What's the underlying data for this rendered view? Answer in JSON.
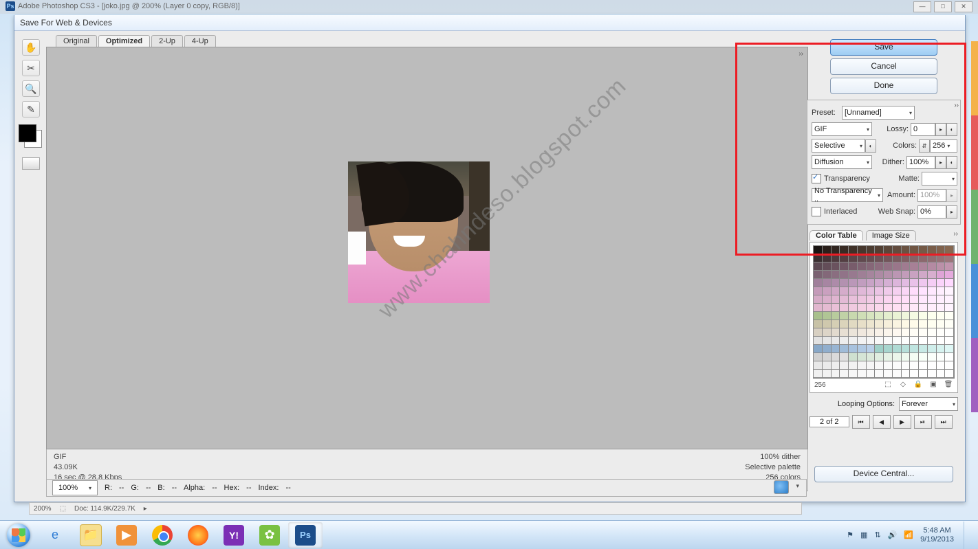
{
  "ps_window": {
    "title": "Adobe Photoshop CS3 - [joko.jpg @ 200% (Layer 0 copy, RGB/8)]"
  },
  "dialog": {
    "title": "Save For Web & Devices",
    "tabs": {
      "original": "Original",
      "optimized": "Optimized",
      "two_up": "2-Up",
      "four_up": "4-Up"
    },
    "watermark": "www.chahndeso.blogspot.com",
    "status_left": {
      "format": "GIF",
      "size": "43.09K",
      "time": "16 sec @ 28.8 Kbps"
    },
    "status_right": {
      "dither": "100% dither",
      "palette": "Selective palette",
      "colors": "256 colors"
    }
  },
  "actions": {
    "save": "Save",
    "cancel": "Cancel",
    "done": "Done",
    "device_central": "Device Central..."
  },
  "settings": {
    "preset_label": "Preset:",
    "preset_value": "[Unnamed]",
    "format_value": "GIF",
    "lossy_label": "Lossy:",
    "lossy_value": "0",
    "reduction_value": "Selective",
    "colors_label": "Colors:",
    "colors_value": "256",
    "dither_method_value": "Diffusion",
    "dither_label": "Dither:",
    "dither_value": "100%",
    "transparency_label": "Transparency",
    "matte_label": "Matte:",
    "trans_dither_value": "No Transparency ..",
    "amount_label": "Amount:",
    "amount_value": "100%",
    "interlaced_label": "Interlaced",
    "websnap_label": "Web Snap:",
    "websnap_value": "0%"
  },
  "panel_tabs": {
    "color_table": "Color Table",
    "image_size": "Image Size"
  },
  "color_table": {
    "count": "256"
  },
  "looping": {
    "label": "Looping Options:",
    "value": "Forever"
  },
  "frames": {
    "pos": "2 of 2"
  },
  "bottom": {
    "zoom": "100%",
    "readout": {
      "r": "R:",
      "g": "G:",
      "b": "B:",
      "alpha": "Alpha:",
      "hex": "Hex:",
      "index": "Index:",
      "dash": "--"
    }
  },
  "ps_strip": {
    "zoom": "200%",
    "doc": "Doc: 114.9K/229.7K"
  },
  "tray": {
    "time": "5:48 AM",
    "date": "9/19/2013"
  },
  "color_palette": [
    "#1a1412",
    "#2a1f1a",
    "#302520",
    "#382b24",
    "#3f3128",
    "#46372d",
    "#4c3c31",
    "#523f33",
    "#5a4639",
    "#624c3e",
    "#6a5242",
    "#705644",
    "#755a47",
    "#7a5e4a",
    "#80624d",
    "#866750",
    "#3a2e30",
    "#443438",
    "#4d3a3e",
    "#533e42",
    "#5a4549",
    "#60494e",
    "#664d52",
    "#6c5156",
    "#72555a",
    "#785a5f",
    "#7e5e63",
    "#856368",
    "#8b686d",
    "#906c71",
    "#967075",
    "#9c757a",
    "#5c4852",
    "#634d58",
    "#6a525e",
    "#715765",
    "#785c6b",
    "#7f6272",
    "#866778",
    "#8d6c7e",
    "#937184",
    "#9a768a",
    "#a07b90",
    "#a78096",
    "#ae859c",
    "#b48aa2",
    "#bb90a8",
    "#c295ae",
    "#7b6272",
    "#836879",
    "#8a6e80",
    "#917388",
    "#98798f",
    "#9f7f96",
    "#a6859d",
    "#ad8aa4",
    "#b490ab",
    "#bb96b3",
    "#c29cba",
    "#c9a2c1",
    "#d0a8c8",
    "#d7aecf",
    "#dea4d6",
    "#e5aadd",
    "#a07f9b",
    "#a785a2",
    "#ad8ba9",
    "#b391b0",
    "#ba97b8",
    "#c19dbf",
    "#c8a3c6",
    "#cfa9cd",
    "#d5afd4",
    "#dcb5db",
    "#e2bbe2",
    "#e9c1e9",
    "#efc7ef",
    "#f5cdf5",
    "#fbd3fb",
    "#ffd9ff",
    "#c49ab9",
    "#caa0bf",
    "#cfa6c5",
    "#d5accb",
    "#dab2d1",
    "#e0b8d8",
    "#e5bede",
    "#ebc4e4",
    "#f0caea",
    "#f5d0f0",
    "#fad6f6",
    "#ffdcfc",
    "#ffe2ff",
    "#ffe8ff",
    "#ffeeff",
    "#fff4ff",
    "#d5aac6",
    "#daafcb",
    "#dfb4d0",
    "#e3bad5",
    "#e8bfda",
    "#edc4df",
    "#f1cae4",
    "#f6cfea",
    "#fad4ef",
    "#fed9f4",
    "#ffdef8",
    "#ffe3fb",
    "#ffe7fd",
    "#ffebff",
    "#ffefff",
    "#fff2ff",
    "#e1b6ce",
    "#e5bbd2",
    "#e9c0d7",
    "#edc5db",
    "#f0cadf",
    "#f4cfe3",
    "#f8d3e8",
    "#fbd8ec",
    "#fedcf0",
    "#ffe0f3",
    "#ffe4f6",
    "#ffe8f9",
    "#ffebfb",
    "#ffeefc",
    "#fff1fe",
    "#fff4ff",
    "#a8c08c",
    "#b0c695",
    "#b8cc9d",
    "#c0d2a6",
    "#c8d8ae",
    "#cfdeb6",
    "#d7e4bf",
    "#dde9c6",
    "#e4eece",
    "#eaf3d5",
    "#f0f7dc",
    "#f5fbe3",
    "#fafee9",
    "#fdffee",
    "#fffff2",
    "#fffff6",
    "#c8c2a6",
    "#cfc8ad",
    "#d5ceb4",
    "#dbd4bb",
    "#e1dac2",
    "#e7dfc8",
    "#ece5cf",
    "#f1ead5",
    "#f6efdb",
    "#faf4e1",
    "#fdf8e6",
    "#fffbea",
    "#fffdee",
    "#fffff1",
    "#fffff4",
    "#fffff7",
    "#d8d0c2",
    "#ddd5c8",
    "#e2dace",
    "#e7dfd3",
    "#ebe4d9",
    "#f0e8de",
    "#f4ede3",
    "#f8f1e8",
    "#fbf5ec",
    "#fef8f0",
    "#fffbf3",
    "#fffdf6",
    "#fffef8",
    "#fffffa",
    "#fffffc",
    "#fffffe",
    "#e2e2e2",
    "#e6e6e6",
    "#e9e9e9",
    "#ededed",
    "#f0f0f0",
    "#f3f3f3",
    "#f5f5f5",
    "#f8f8f8",
    "#fafafa",
    "#fcfcfc",
    "#fdfdfd",
    "#fefefe",
    "#ffffff",
    "#ffffff",
    "#ffffff",
    "#ffffff",
    "#88a8c8",
    "#90aecd",
    "#98b5d3",
    "#a0bcd8",
    "#a8c2de",
    "#b0c9e3",
    "#b8cfe8",
    "#9fd0c8",
    "#a7d5ce",
    "#afdad4",
    "#b7dfda",
    "#bfe4e0",
    "#c7e9e5",
    "#cfeeeb",
    "#d7f3f0",
    "#dff7f5",
    "#d0d0d0",
    "#d5d5d5",
    "#dadada",
    "#dfdfdf",
    "#cfe0d0",
    "#d5e5d6",
    "#dbe9db",
    "#e0eee1",
    "#e6f2e6",
    "#ebf6eb",
    "#f0faf0",
    "#f4fdf4",
    "#f8fff8",
    "#fbfffb",
    "#fdfffd",
    "#ffffff",
    "#e8e8e8",
    "#ebebeb",
    "#ededed",
    "#f0f0f0",
    "#f2f2f2",
    "#f4f4f4",
    "#f6f6f6",
    "#f8f8f8",
    "#fafafa",
    "#fbfbfb",
    "#fcfcfc",
    "#fdfdfd",
    "#fefefe",
    "#fefefe",
    "#ffffff",
    "#ffffff",
    "#f0f0f0",
    "#f2f2f2",
    "#f4f4f4",
    "#f5f5f5",
    "#f7f7f7",
    "#f8f8f8",
    "#f9f9f9",
    "#fafafa",
    "#fbfbfb",
    "#fcfcfc",
    "#fdfdfd",
    "#fdfdfd",
    "#fefefe",
    "#fefefe",
    "#ffffff",
    "#ffffff"
  ]
}
